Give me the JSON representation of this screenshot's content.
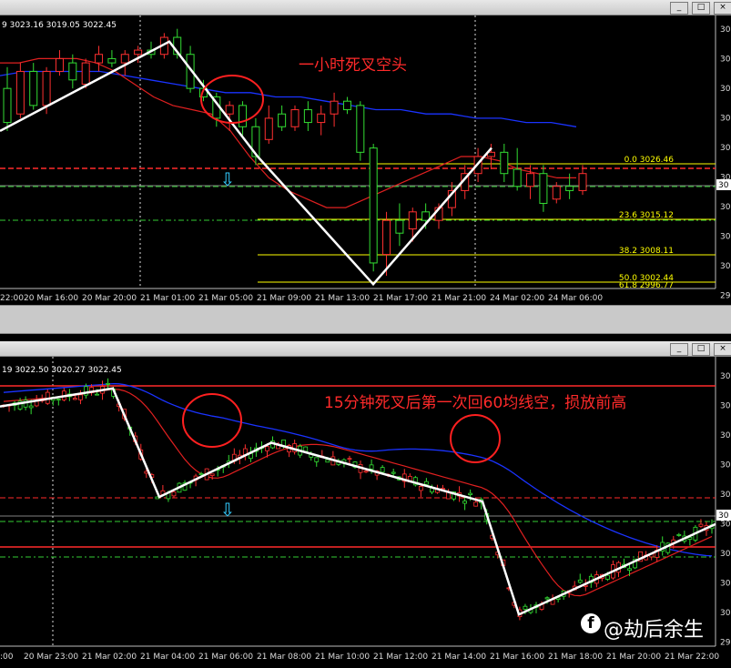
{
  "chart_data": [
    {
      "type": "candlestick",
      "timeframe_annotation": "一小时死叉空头",
      "ohlc_header": "9 3023.16 3019.05 3022.45",
      "x_ticks": [
        "22:00",
        "20 Mar 16:00",
        "20 Mar 20:00",
        "21 Mar 01:00",
        "21 Mar 05:00",
        "21 Mar 09:00",
        "21 Mar 13:00",
        "21 Mar 17:00",
        "21 Mar 21:00",
        "24 Mar 02:00",
        "24 Mar 06:00"
      ],
      "y_tick_labels": [
        "30",
        "30",
        "30",
        "30",
        "30",
        "30",
        "30",
        "30",
        "30",
        "29"
      ],
      "fibonacci": [
        {
          "level": "0.0",
          "price": "3026.46"
        },
        {
          "level": "23.6",
          "price": "3015.12"
        },
        {
          "level": "38.2",
          "price": "3008.11"
        },
        {
          "level": "50.0",
          "price": "3002.44"
        },
        {
          "level": "61.8",
          "price": "2996.77"
        }
      ],
      "price_range": [
        2993,
        3055
      ],
      "candles": [
        [
          3040,
          3045,
          3030,
          3032
        ],
        [
          3034,
          3046,
          3033,
          3044
        ],
        [
          3044,
          3046,
          3035,
          3036
        ],
        [
          3036,
          3045,
          3034,
          3044
        ],
        [
          3044,
          3049,
          3043,
          3047
        ],
        [
          3046,
          3048,
          3040,
          3042
        ],
        [
          3041,
          3047,
          3040,
          3046
        ],
        [
          3046,
          3050,
          3044,
          3048
        ],
        [
          3047,
          3049,
          3045,
          3046
        ],
        [
          3046,
          3049,
          3043,
          3048
        ],
        [
          3048,
          3050,
          3046,
          3049
        ],
        [
          3049,
          3051,
          3047,
          3048
        ],
        [
          3048,
          3053,
          3047,
          3052
        ],
        [
          3052,
          3054,
          3047,
          3048
        ],
        [
          3048,
          3050,
          3039,
          3040
        ],
        [
          3040,
          3042,
          3037,
          3038
        ],
        [
          3038,
          3039,
          3031,
          3033
        ],
        [
          3034,
          3037,
          3030,
          3036
        ],
        [
          3036,
          3037,
          3029,
          3031
        ],
        [
          3031,
          3033,
          3022,
          3024
        ],
        [
          3028,
          3036,
          3027,
          3033
        ],
        [
          3034,
          3036,
          3030,
          3031
        ],
        [
          3031,
          3036,
          3030,
          3035
        ],
        [
          3035,
          3037,
          3030,
          3032
        ],
        [
          3032,
          3036,
          3029,
          3034
        ],
        [
          3034,
          3039,
          3031,
          3037
        ],
        [
          3037,
          3038,
          3034,
          3035
        ],
        [
          3036,
          3037,
          3023,
          3025
        ],
        [
          3026,
          3027,
          2997,
          2999
        ],
        [
          3001,
          3011,
          2996,
          3009
        ],
        [
          3009,
          3013,
          3003,
          3006
        ],
        [
          3007,
          3012,
          3004,
          3011
        ],
        [
          3011,
          3013,
          3007,
          3009
        ],
        [
          3009,
          3013,
          3007,
          3012
        ],
        [
          3012,
          3018,
          3010,
          3016
        ],
        [
          3016,
          3022,
          3014,
          3020
        ],
        [
          3020,
          3026,
          3018,
          3024
        ],
        [
          3024,
          3027,
          3021,
          3025
        ],
        [
          3025,
          3027,
          3018,
          3020
        ],
        [
          3021,
          3026,
          3016,
          3017
        ],
        [
          3017,
          3022,
          3014,
          3020
        ],
        [
          3020,
          3022,
          3011,
          3013
        ],
        [
          3014,
          3018,
          3013,
          3017
        ],
        [
          3017,
          3020,
          3014,
          3016
        ],
        [
          3016,
          3022,
          3015,
          3020
        ]
      ],
      "ma_fast": [
        3046,
        3046,
        3047,
        3047,
        3047,
        3046,
        3044,
        3041,
        3038,
        3036,
        3035,
        3034,
        3030,
        3024,
        3019,
        3016,
        3014,
        3012,
        3012,
        3014,
        3016,
        3018,
        3020,
        3022,
        3024,
        3024,
        3023,
        3021,
        3020,
        3019,
        3019
      ],
      "ma_slow": [
        3043,
        3044,
        3044,
        3044,
        3044,
        3043,
        3042,
        3041,
        3040,
        3039,
        3039,
        3038,
        3038,
        3037,
        3036,
        3035,
        3035,
        3034,
        3034,
        3033,
        3033,
        3032,
        3032,
        3031
      ],
      "zigzag_prices": [
        3030,
        3051,
        3024,
        2994,
        3026
      ],
      "arrow": "⇩"
    },
    {
      "type": "candlestick",
      "timeframe_annotation": "15分钟死叉后第一次回60均线空，损放前高",
      "ohlc_header": "19 3022.50 3020.27 3022.45",
      "x_ticks": [
        ":00",
        "20 Mar 23:00",
        "21 Mar 02:00",
        "21 Mar 04:00",
        "21 Mar 06:00",
        "21 Mar 08:00",
        "21 Mar 10:00",
        "21 Mar 12:00",
        "21 Mar 14:00",
        "21 Mar 16:00",
        "21 Mar 18:00",
        "21 Mar 20:00",
        "21 Mar 22:00"
      ],
      "y_tick_labels": [
        "30",
        "30",
        "30",
        "30",
        "30",
        "30",
        "30",
        "30",
        "30",
        "29"
      ],
      "price_range": [
        2993,
        3055
      ],
      "arrow": "⇩",
      "zigzag_prices": [
        3046,
        3050,
        3026,
        3038,
        3025,
        3000,
        3020
      ]
    }
  ],
  "watermark": {
    "logo": "f",
    "text": "@劫后余生"
  },
  "window_buttons": [
    "_",
    "□",
    "×"
  ]
}
